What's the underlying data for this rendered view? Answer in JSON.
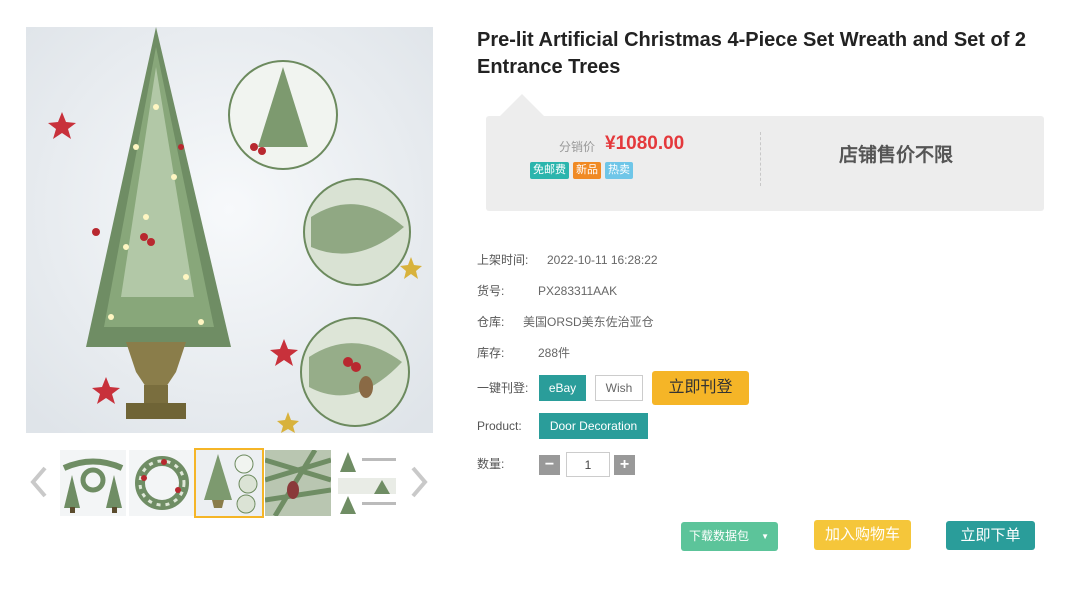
{
  "product": {
    "title": "Pre-lit Artificial Christmas 4-Piece Set Wreath and Set of 2 Entrance Trees"
  },
  "price_box": {
    "price_label": "分销价",
    "price_value": "¥1080.00",
    "badges": [
      {
        "text": "免邮费",
        "color": "#2bb5ad"
      },
      {
        "text": "新品",
        "color": "#f08a24"
      },
      {
        "text": "热卖",
        "color": "#6fc6e8"
      }
    ],
    "shop_price": "店铺售价不限"
  },
  "info": {
    "listing_time_label": "上架时间:",
    "listing_time_value": "2022-10-11 16:28:22",
    "sku_label": "货号:",
    "sku_value": "PX283311AAK",
    "warehouse_label": "仓库:",
    "warehouse_value": "美国ORSD美东佐治亚仓",
    "stock_label": "库存:",
    "stock_value": "288件",
    "publish_label": "一键刊登:",
    "product_label": "Product:",
    "quantity_label": "数量:"
  },
  "buttons": {
    "ebay": "eBay",
    "wish": "Wish",
    "publish_now": "立即刊登",
    "product_type": "Door Decoration",
    "qty_minus": "−",
    "qty_plus": "+",
    "download": "下载数据包",
    "add_to_cart": "加入购物车",
    "buy_now": "立即下单"
  },
  "quantity": {
    "value": "1"
  },
  "gallery": {
    "thumbnails": [
      "wreath-set",
      "wreath",
      "tree-main",
      "tree-closeup",
      "info-sheet"
    ],
    "active_index": 2
  },
  "colors": {
    "accent_teal": "#2a9d9a",
    "accent_yellow": "#f5b527",
    "price_red": "#e4393c",
    "download_green": "#5cc49a"
  }
}
